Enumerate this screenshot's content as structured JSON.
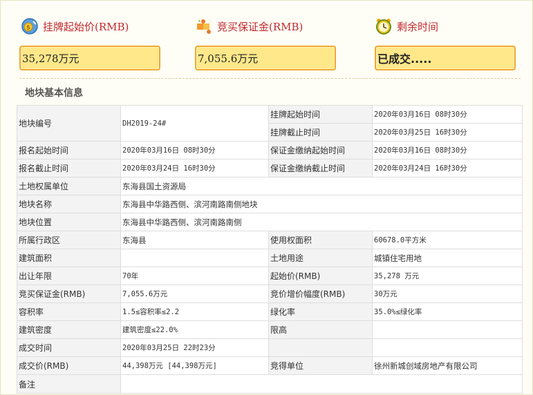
{
  "stats": {
    "start_price": {
      "label": "挂牌起始价(RMB)",
      "value": "35,278万元",
      "icon": "money-coin-icon"
    },
    "deposit": {
      "label": "竞买保证金(RMB)",
      "value": "7,055.6万元",
      "icon": "puzzle-icon"
    },
    "remaining": {
      "label": "剩余时间",
      "value": "已成交.....",
      "icon": "alarm-clock-icon"
    }
  },
  "section_title": "地块基本信息",
  "table": {
    "parcel_no_label": "地块编号",
    "parcel_no": "DH2019-24#",
    "list_start_label": "挂牌起始时间",
    "list_start": "2020年03月16日 08时30分",
    "list_end_label": "挂牌截止时间",
    "list_end": "2020年03月25日 16时30分",
    "reg_start_label": "报名起始时间",
    "reg_start": "2020年03月16日 08时30分",
    "dep_start_label": "保证金缴纳起始时间",
    "dep_start": "2020年03月16日 08时30分",
    "reg_end_label": "报名截止时间",
    "reg_end": "2020年03月24日 16时30分",
    "dep_end_label": "保证金缴纳截止时间",
    "dep_end": "2020年03月24日 16时30分",
    "owner_label": "土地权属单位",
    "owner": "东海县国土资源局",
    "name_label": "地块名称",
    "name": "东海县中华路西侧、滨河南路南侧地块",
    "location_label": "地块位置",
    "location": "东海县中华路西侧、滨河南路南侧",
    "district_label": "所属行政区",
    "district": "东海县",
    "use_area_label": "使用权面积",
    "use_area": "60678.0平方米",
    "build_area_label": "建筑面积",
    "build_area": "",
    "land_use_label": "土地用途",
    "land_use": "城镇住宅用地",
    "term_label": "出让年限",
    "term": "70年",
    "start_price_label": "起始价(RMB)",
    "start_price": "35,278 万元",
    "deposit_label": "竞买保证金(RMB)",
    "deposit": "7,055.6万元",
    "increment_label": "竞价增价幅度(RMB)",
    "increment": "30万元",
    "far_label": "容积率",
    "far": "1.5≤容积率≤2.2",
    "green_label": "绿化率",
    "green": "35.0%≤绿化率",
    "density_label": "建筑密度",
    "density": "建筑密度≤22.0%",
    "height_label": "限高",
    "height": "",
    "deal_time_label": "成交时间",
    "deal_time": "2020年03月25日 22时23分",
    "deal_price_label": "成交价(RMB)",
    "deal_price": "44,398万元 [44,398万元]",
    "winner_label": "竞得单位",
    "winner": "徐州新城创域房地产有限公司",
    "remark_label": "备注",
    "remark": ""
  }
}
